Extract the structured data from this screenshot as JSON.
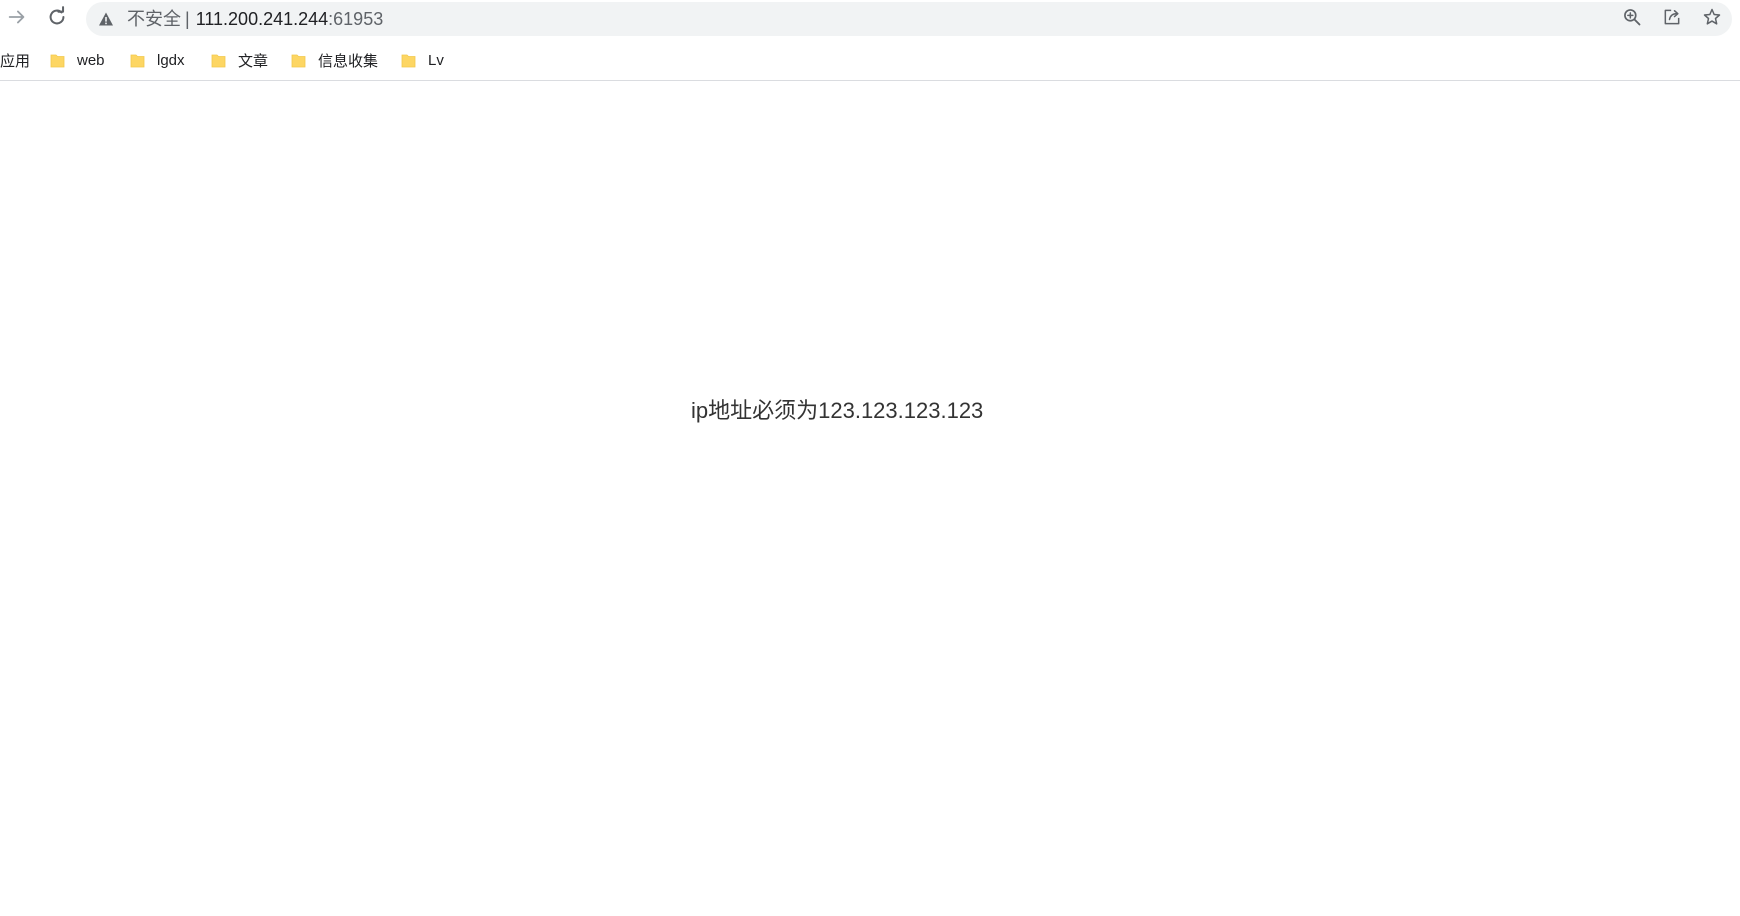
{
  "browser": {
    "address_bar": {
      "security_label": "不安全",
      "separator": "|",
      "host": "111.200.241.244",
      "port": ":61953"
    },
    "icons": {
      "forward": "arrow-right-icon",
      "reload": "reload-icon",
      "warning": "warning-triangle-icon",
      "zoom": "zoom-in-icon",
      "share": "share-icon",
      "bookmark": "star-icon",
      "folder": "folder-icon"
    },
    "bookmarks_bar": {
      "apps_label": "应用",
      "folders": [
        {
          "label": "web"
        },
        {
          "label": "lgdx"
        },
        {
          "label": "文章"
        },
        {
          "label": "信息收集"
        },
        {
          "label": "Lv"
        }
      ]
    }
  },
  "page": {
    "message": "ip地址必须为123.123.123.123"
  },
  "colors": {
    "omnibox_bg": "#f1f3f4",
    "folder_fill": "#fdd663",
    "text_primary": "#202124",
    "text_secondary": "#5f6368",
    "message_text": "#333333"
  }
}
